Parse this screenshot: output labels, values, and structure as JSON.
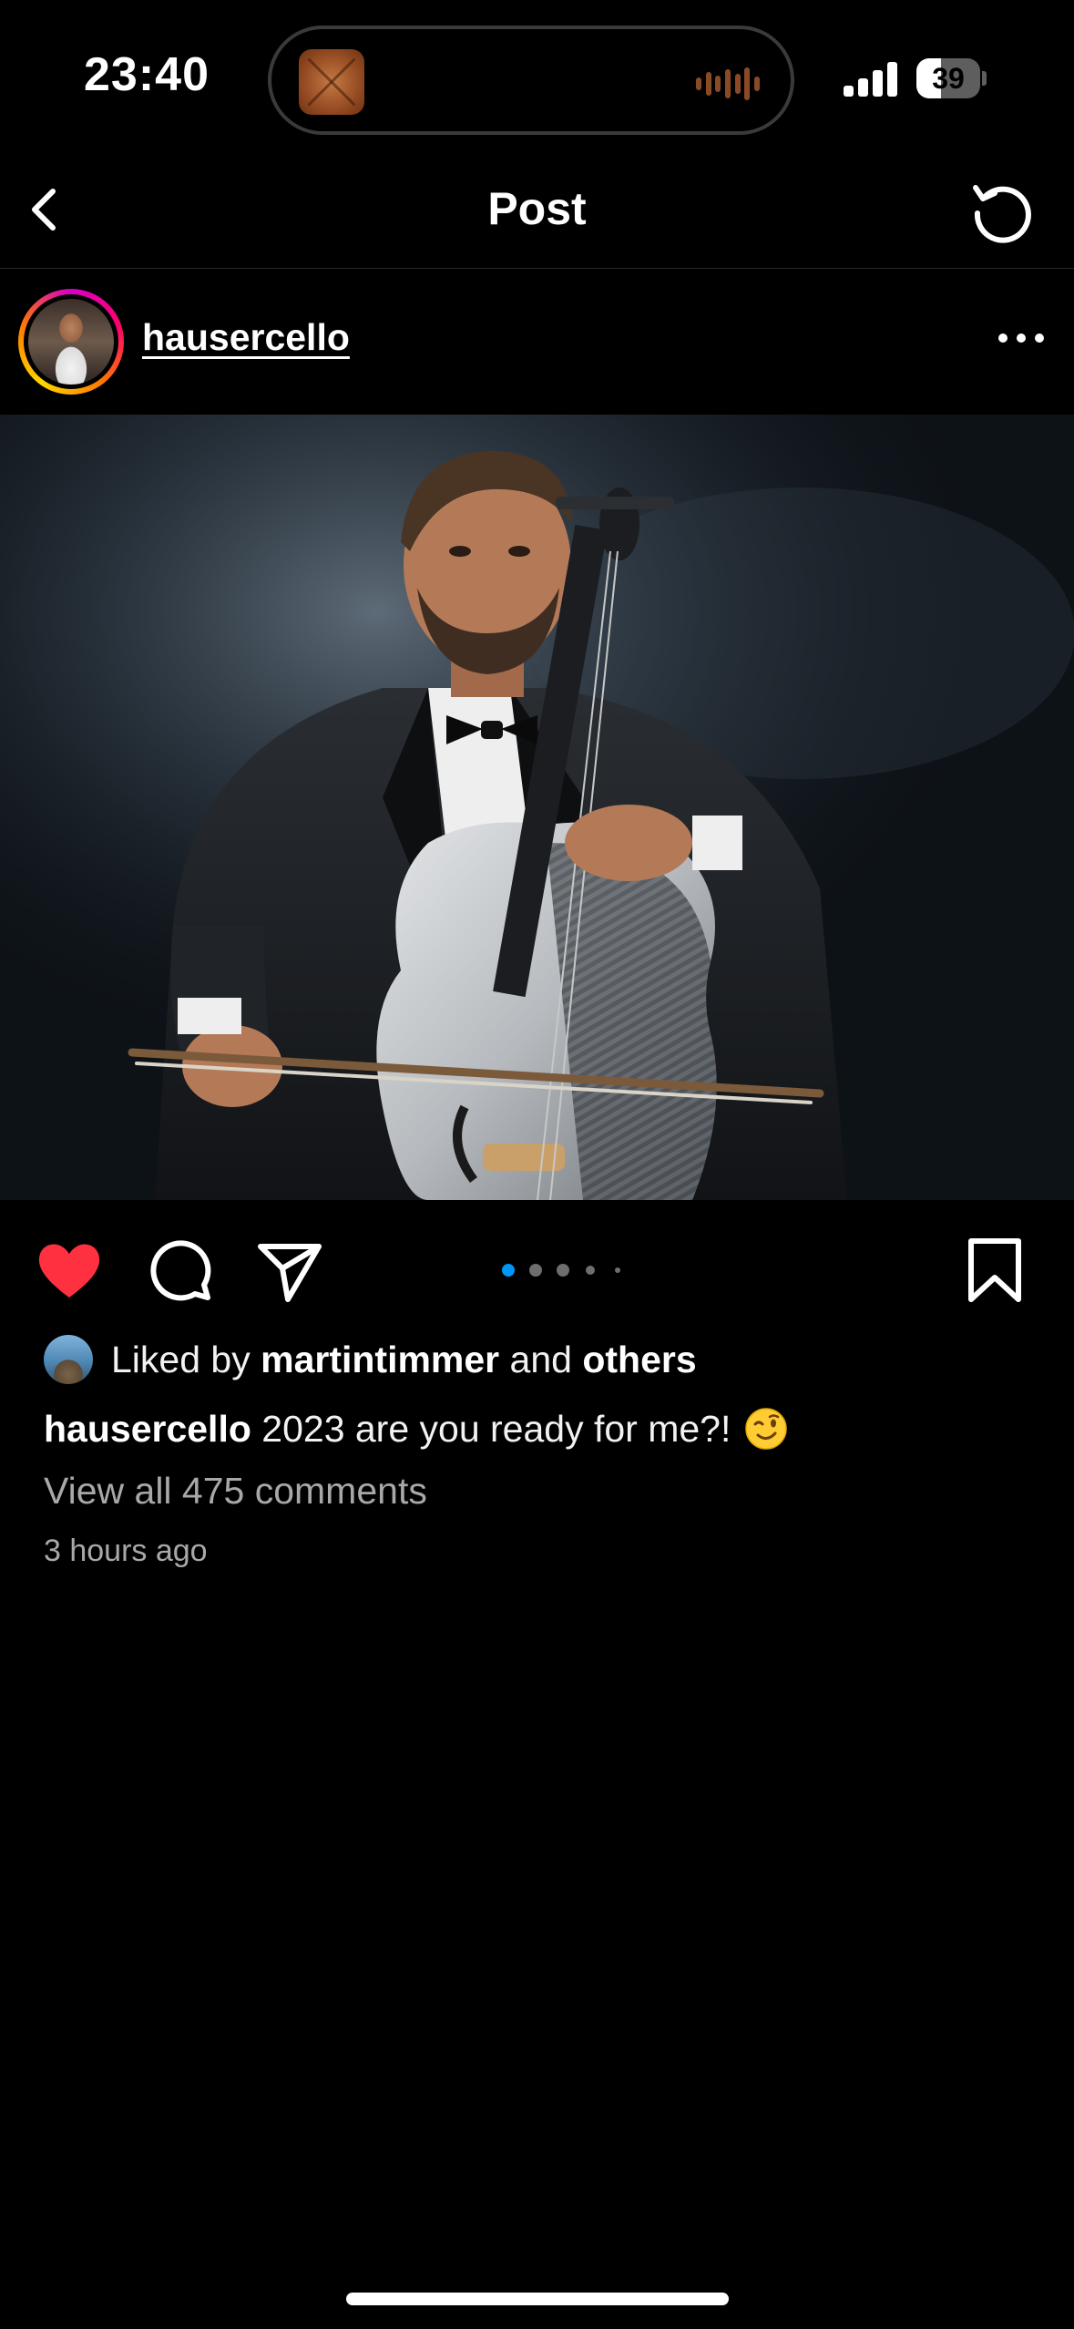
{
  "status_bar": {
    "time": "23:40",
    "battery_level": "39",
    "battery_fraction": 0.39
  },
  "header": {
    "title": "Post",
    "back_icon": "chevron-left-icon",
    "refresh_icon": "refresh-icon"
  },
  "post": {
    "username": "hausercello",
    "more_icon": "more-horizontal-icon",
    "image_alt": "Cellist in a tuxedo playing a carbon-fiber cello against a dark smoky background"
  },
  "actions": {
    "like_icon": "heart-filled-icon",
    "comment_icon": "comment-icon",
    "share_icon": "share-icon",
    "save_icon": "bookmark-icon",
    "liked": true,
    "like_color": "#ff3040",
    "carousel": {
      "total": 5,
      "active_index": 0,
      "active_color": "#0095f6"
    }
  },
  "likes": {
    "prefix": "Liked by ",
    "user": "martintimmer",
    "middle": " and ",
    "others": "others"
  },
  "caption": {
    "username": "hausercello",
    "text": " 2023 are you ready for me?!",
    "emoji": "wink-emoji"
  },
  "comments": {
    "link_text": "View all 475 comments"
  },
  "timestamp": "3 hours ago"
}
